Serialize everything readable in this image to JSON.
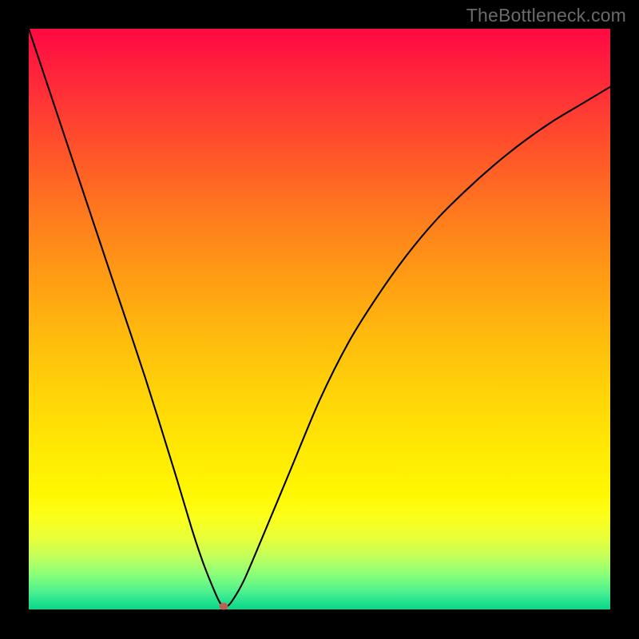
{
  "watermark": "TheBottleneck.com",
  "marker_color": "#c65a54",
  "chart_data": {
    "type": "line",
    "title": "",
    "xlabel": "",
    "ylabel": "",
    "xlim": [
      0,
      100
    ],
    "ylim": [
      0,
      100
    ],
    "series": [
      {
        "name": "bottleneck-curve",
        "x": [
          0,
          5,
          10,
          15,
          20,
          25,
          28,
          30,
          32,
          33,
          34,
          35,
          37,
          40,
          45,
          50,
          55,
          60,
          65,
          70,
          75,
          80,
          85,
          90,
          95,
          100
        ],
        "y": [
          100,
          85,
          70,
          55,
          40,
          24,
          14,
          8,
          3,
          1,
          0.5,
          1.5,
          5,
          12,
          24,
          36,
          46,
          54,
          61,
          67,
          72,
          76.5,
          80.5,
          84,
          87,
          90
        ]
      }
    ],
    "markers": [
      {
        "name": "current-point",
        "x": 33.5,
        "y": 0.5
      }
    ],
    "annotations": []
  }
}
